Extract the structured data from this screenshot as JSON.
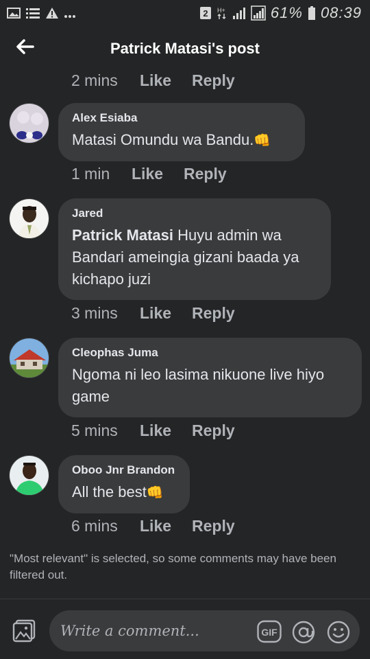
{
  "status_bar": {
    "sim_badge": "2",
    "battery_text": "61%",
    "time": "08:39",
    "icons": [
      "image-icon",
      "list-icon",
      "warning-icon",
      "more-dots-icon",
      "sim-icon",
      "hplus-icon",
      "signal-icon",
      "signal-icon",
      "battery-icon"
    ]
  },
  "header": {
    "title": "Patrick Matasi's post",
    "back_icon": "back-arrow-icon"
  },
  "first_meta": {
    "time": "2 mins",
    "like": "Like",
    "reply": "Reply"
  },
  "comments": [
    {
      "author": "Alex Esiaba",
      "mention": "",
      "text": "Matasi Omundu wa Bandu.",
      "emoji": "👊",
      "time": "1 min",
      "like": "Like",
      "reply": "Reply"
    },
    {
      "author": "Jared",
      "mention": "Patrick Matasi",
      "text": " Huyu admin wa Bandari ameingia gizani baada ya kichapo juzi",
      "emoji": "",
      "time": "3 mins",
      "like": "Like",
      "reply": "Reply"
    },
    {
      "author": "Cleophas Juma",
      "mention": "",
      "text": "Ngoma ni leo lasima nikuone live hiyo game",
      "emoji": "",
      "time": "5 mins",
      "like": "Like",
      "reply": "Reply"
    },
    {
      "author": "Oboo Jnr Brandon",
      "mention": "",
      "text": "All the best",
      "emoji": "👊",
      "time": "6 mins",
      "like": "Like",
      "reply": "Reply"
    }
  ],
  "notice": "\"Most relevant\" is selected, so some comments may have been filtered out.",
  "composer": {
    "placeholder": "Write a comment...",
    "gif_label": "GIF",
    "icons": [
      "photo-icon",
      "gif-icon",
      "mention-icon",
      "emoji-icon"
    ]
  }
}
